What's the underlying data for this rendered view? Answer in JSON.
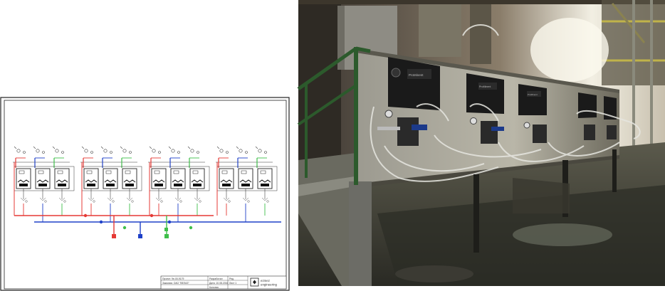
{
  "diagram": {
    "title_block": {
      "cells": [
        "Проект: 9е-00-9179",
        "Заказчик: ОАО \"ВЕЛАЗ\"",
        "Разработал",
        "Дата: 10.08.2016",
        "Колонок",
        "Ред.",
        "Лист 1"
      ],
      "company_name": "ezmez",
      "company_sub": "engineering"
    },
    "colors": {
      "red": "#e53935",
      "blue": "#1e40c8",
      "green": "#3fbf4a",
      "frame": "#222222"
    },
    "groups_count": 4,
    "units_per_group": 3
  },
  "photo": {
    "panel_labels": [
      "ProMinent",
      "ProMinent",
      "ProMinent"
    ]
  }
}
